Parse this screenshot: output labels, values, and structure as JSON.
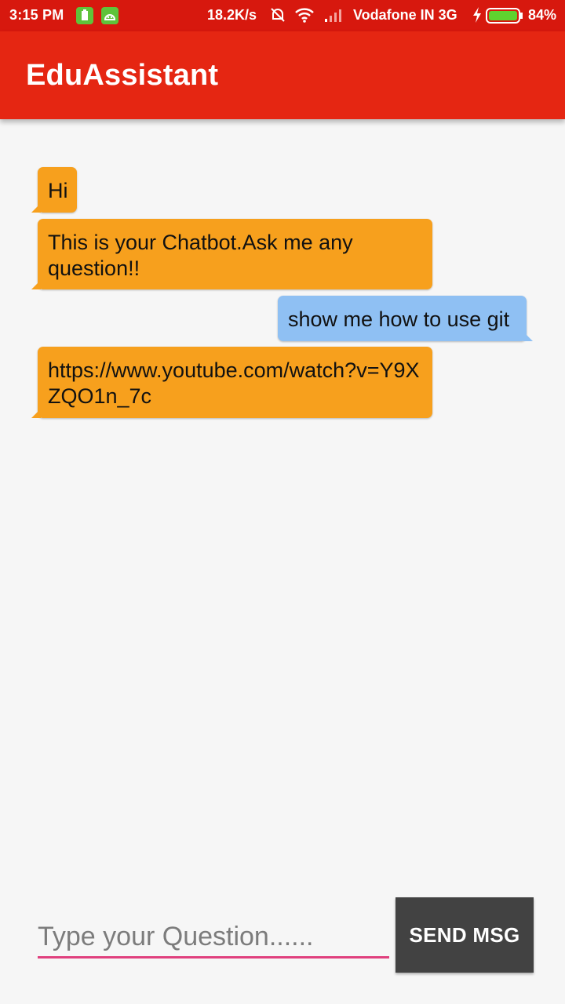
{
  "status_bar": {
    "time": "3:15 PM",
    "net_speed": "18.2K/s",
    "carrier": "Vodafone IN 3G",
    "battery_percent": "84%",
    "icons": [
      "app-notification-icon",
      "android-icon",
      "mute-bell-icon",
      "wifi-icon",
      "signal-icon",
      "charging-icon",
      "battery-icon"
    ]
  },
  "app_bar": {
    "title": "EduAssistant",
    "color": "#e52612"
  },
  "messages": [
    {
      "sender": "bot",
      "text": "Hi"
    },
    {
      "sender": "bot",
      "text": "This is your Chatbot.Ask me any question!!"
    },
    {
      "sender": "user",
      "text": "show me how to use git"
    },
    {
      "sender": "bot",
      "text": "https://www.youtube.com/watch?v=Y9XZQO1n_7c"
    }
  ],
  "input": {
    "placeholder": "Type your Question......",
    "value": ""
  },
  "send_button": {
    "label": "SEND MSG"
  },
  "colors": {
    "bot_bubble": "#f7a01d",
    "user_bubble": "#8fc0f3",
    "input_underline": "#e0407e",
    "send_button": "#424242"
  }
}
